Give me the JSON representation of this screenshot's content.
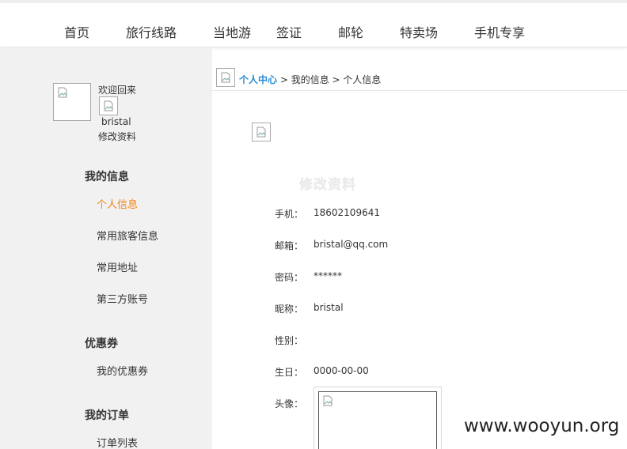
{
  "nav": {
    "items": [
      "首页",
      "旅行线路",
      "当地游",
      "签证",
      "邮轮",
      "特卖场",
      "手机专享"
    ]
  },
  "sidebar": {
    "welcome": "欢迎回来",
    "username": "bristal",
    "edit_profile": "修改资料",
    "sections": [
      {
        "title": "我的信息",
        "links": [
          "个人信息",
          "常用旅客信息",
          "常用地址",
          "第三方账号"
        ]
      },
      {
        "title": "优惠券",
        "links": [
          "我的优惠券"
        ]
      },
      {
        "title": "我的订单",
        "links": [
          "订单列表"
        ]
      }
    ],
    "active_link": "个人信息"
  },
  "breadcrumb": {
    "root": "个人中心",
    "sep": " > ",
    "level2": "我的信息",
    "level3": "个人信息"
  },
  "form": {
    "title": "修改资料",
    "fields": [
      {
        "label": "手机：",
        "value": "18602109641"
      },
      {
        "label": "邮箱：",
        "value": "bristal@qq.com"
      },
      {
        "label": "密码：",
        "value": "******"
      },
      {
        "label": "昵称：",
        "value": "bristal"
      },
      {
        "label": "性别：",
        "value": ""
      },
      {
        "label": "生日：",
        "value": "0000-00-00"
      },
      {
        "label": "头像：",
        "value": ""
      }
    ]
  },
  "watermark": "www.wooyun.org",
  "colors": {
    "accent_orange": "#f08519",
    "link_blue": "#2a8bd3",
    "sidebar_bg": "#f1f1f1"
  }
}
